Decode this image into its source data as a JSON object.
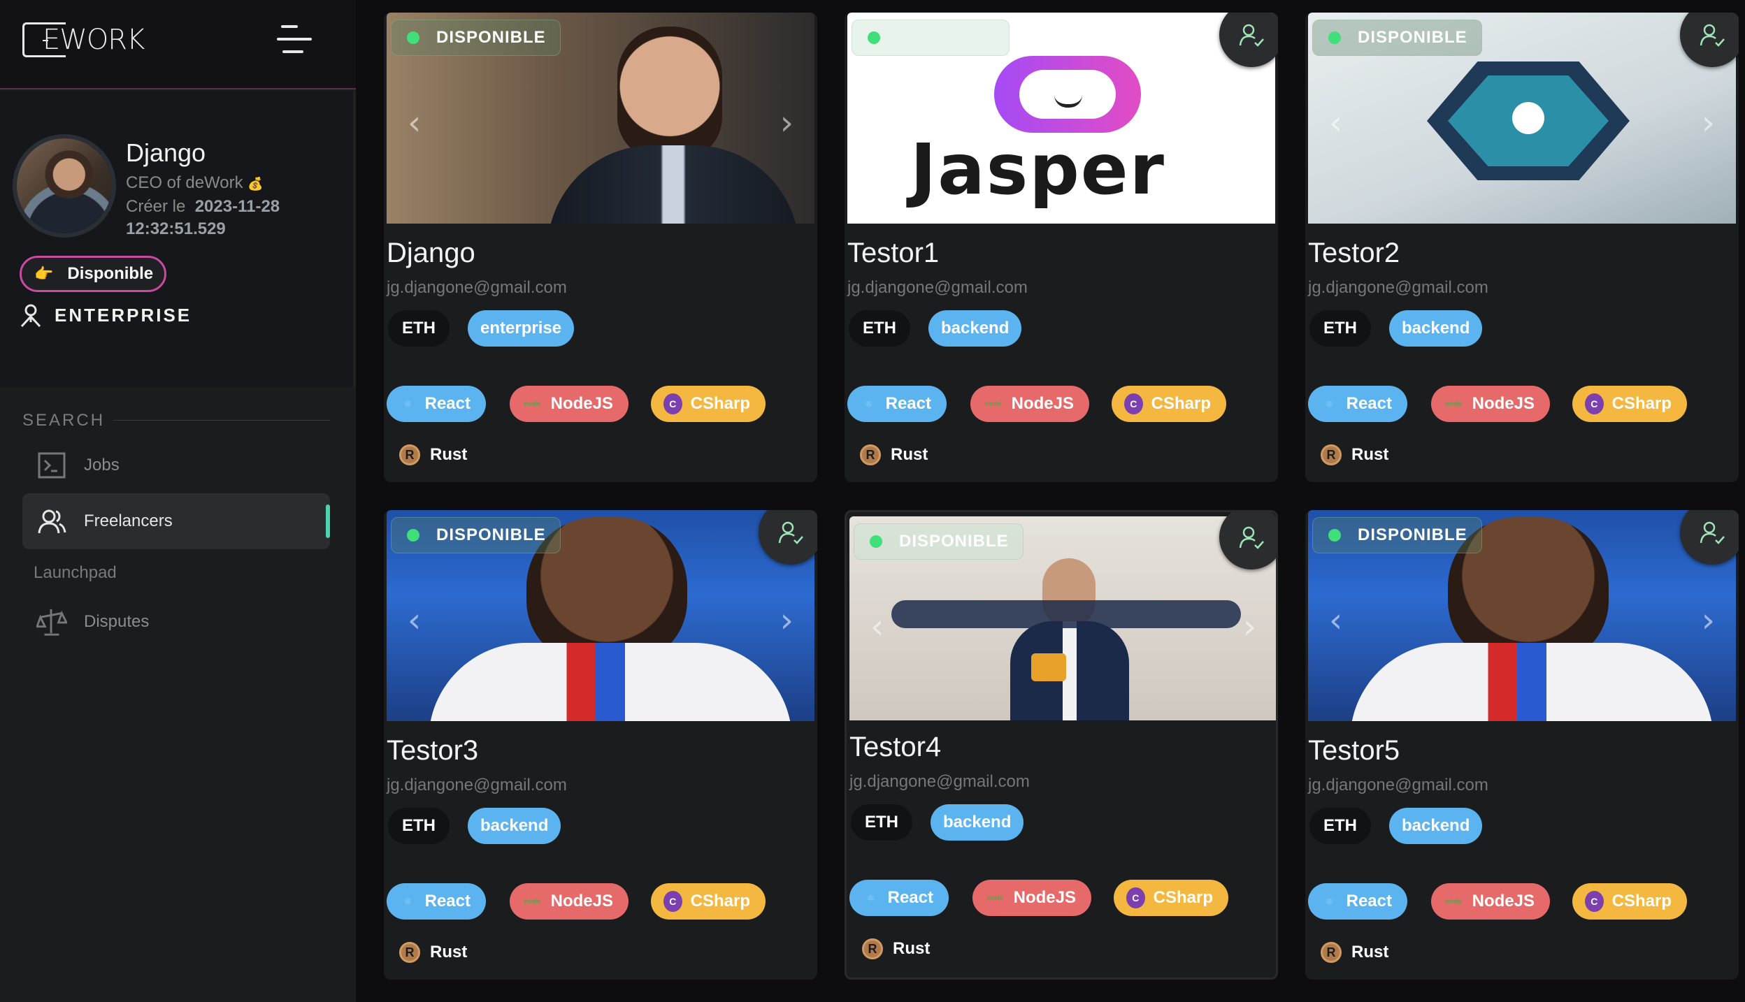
{
  "brand": {
    "logo_text": "EWORK"
  },
  "profile": {
    "name": "Django",
    "role": "CEO of deWork",
    "role_badge": "💰",
    "created_label": "Créer le",
    "created_value": "2023-11-28 12:32:51.529",
    "status": "Disponible",
    "account_type": "ENTERPRISE"
  },
  "nav": {
    "section_label": "SEARCH",
    "jobs": "Jobs",
    "freelancers": "Freelancers",
    "launchpad": "Launchpad",
    "disputes": "Disputes"
  },
  "colors": {
    "accent": "#4fd1b0",
    "status_ring": "#c94aa0",
    "react": "#5bb4f0",
    "node": "#e66a6a",
    "csharp": "#f4b840"
  },
  "cards": [
    {
      "name": "Django",
      "email": "jg.djangone@gmail.com",
      "currency": "ETH",
      "role": "enterprise",
      "badge": "DISPONIBLE",
      "skills": [
        "React",
        "NodeJS",
        "CSharp",
        "Rust"
      ]
    },
    {
      "name": "Testor1",
      "email": "jg.djangone@gmail.com",
      "currency": "ETH",
      "role": "backend",
      "badge": "",
      "image_text": "Jasper",
      "skills": [
        "React",
        "NodeJS",
        "CSharp",
        "Rust"
      ]
    },
    {
      "name": "Testor2",
      "email": "jg.djangone@gmail.com",
      "currency": "ETH",
      "role": "backend",
      "badge": "DISPONIBLE",
      "skills": [
        "React",
        "NodeJS",
        "CSharp",
        "Rust"
      ]
    },
    {
      "name": "Testor3",
      "email": "jg.djangone@gmail.com",
      "currency": "ETH",
      "role": "backend",
      "badge": "DISPONIBLE",
      "skills": [
        "React",
        "NodeJS",
        "CSharp",
        "Rust"
      ]
    },
    {
      "name": "Testor4",
      "email": "jg.djangone@gmail.com",
      "currency": "ETH",
      "role": "backend",
      "badge": "DISPONIBLE",
      "skills": [
        "React",
        "NodeJS",
        "CSharp",
        "Rust"
      ]
    },
    {
      "name": "Testor5",
      "email": "jg.djangone@gmail.com",
      "currency": "ETH",
      "role": "backend",
      "badge": "DISPONIBLE",
      "skills": [
        "React",
        "NodeJS",
        "CSharp",
        "Rust"
      ]
    }
  ]
}
